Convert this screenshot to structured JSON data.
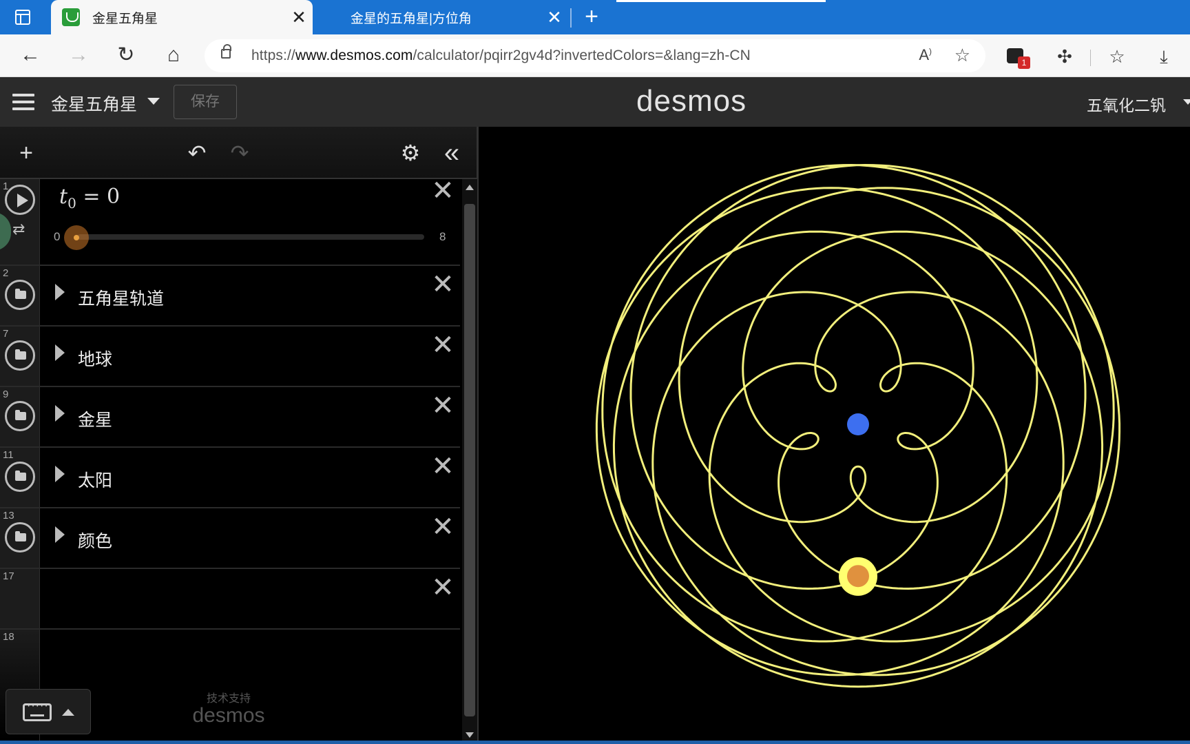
{
  "browser": {
    "tabs": [
      {
        "title": "金星五角星",
        "active": true
      },
      {
        "title": "金星的五角星|方位角",
        "active": false
      }
    ],
    "url_prefix": "https://",
    "url_host": "www.desmos.com",
    "url_path": "/calculator/pqirr2gv4d?invertedColors=&lang=zh-CN",
    "extension_badge": "1"
  },
  "header": {
    "graph_title": "金星五角星",
    "save_label": "保存",
    "logo": "desmos",
    "user_name": "五氧化二钒"
  },
  "expressions": [
    {
      "index": "1",
      "type": "slider",
      "var": "t",
      "sub": "0",
      "op": "=",
      "value": "0",
      "min": "0",
      "max": "8",
      "fraction": 0.0
    },
    {
      "index": "2",
      "type": "folder",
      "label": "五角星轨道"
    },
    {
      "index": "7",
      "type": "folder",
      "label": "地球"
    },
    {
      "index": "9",
      "type": "folder",
      "label": "金星"
    },
    {
      "index": "11",
      "type": "folder",
      "label": "太阳"
    },
    {
      "index": "13",
      "type": "folder",
      "label": "颜色"
    },
    {
      "index": "17",
      "type": "empty"
    },
    {
      "index": "18",
      "type": "empty"
    }
  ],
  "footer": {
    "powered_by": "技术支持",
    "powered_logo": "desmos"
  },
  "colors": {
    "orbit": "#f2ef7c",
    "sun": "#ffff70",
    "earth": "#3d6ff0",
    "venus": "#e0913e",
    "background": "#000000"
  },
  "graph": {
    "curve": "Venus pentagram trace (geocentric)",
    "bodies": [
      "sun",
      "earth",
      "venus"
    ]
  }
}
